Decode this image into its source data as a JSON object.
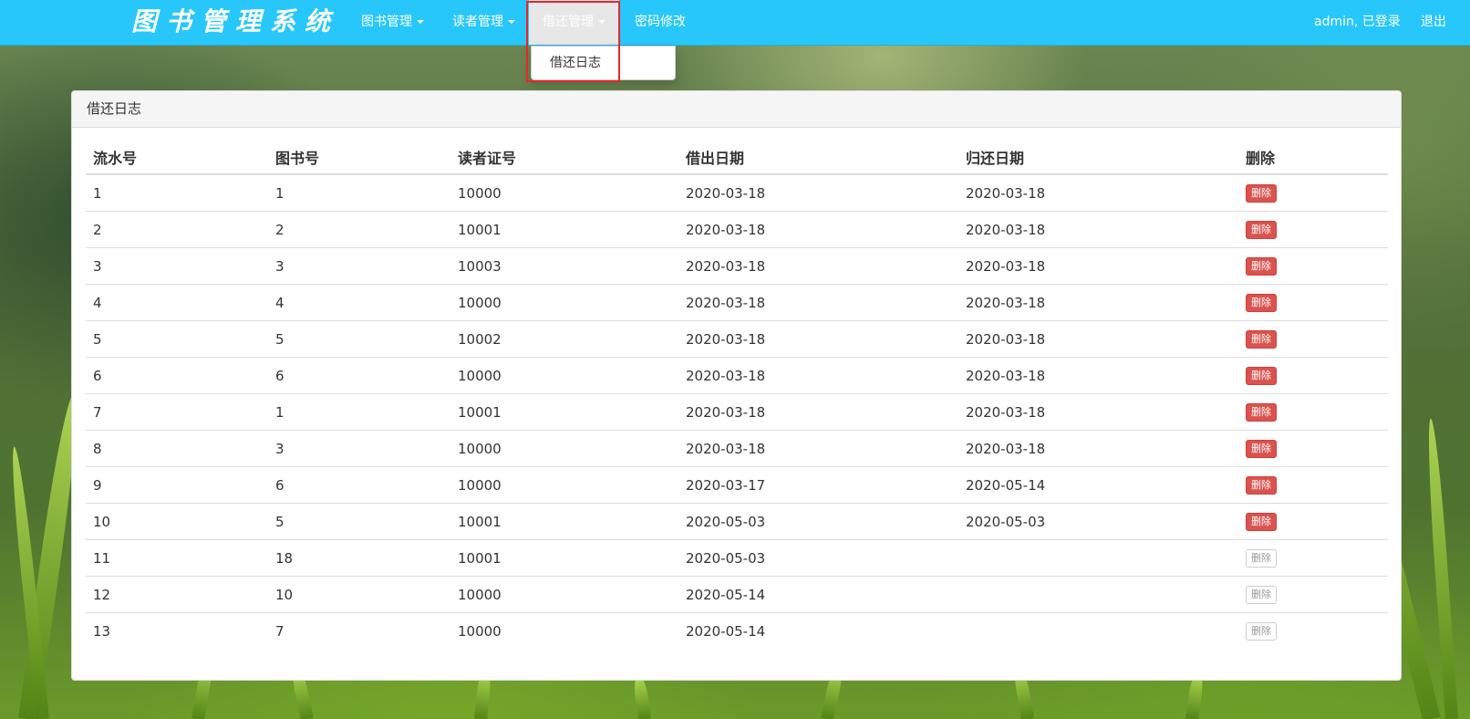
{
  "navbar": {
    "brand": "图书管理系统",
    "items": [
      {
        "label": "图书管理",
        "dropdown": true
      },
      {
        "label": "读者管理",
        "dropdown": true
      },
      {
        "label": "借还管理",
        "dropdown": true
      },
      {
        "label": "密码修改",
        "dropdown": false
      }
    ],
    "user_status": "admin, 已登录",
    "logout": "退出"
  },
  "dropdown": {
    "items": [
      {
        "label": "借还日志"
      }
    ]
  },
  "panel": {
    "title": "借还日志",
    "columns": [
      "流水号",
      "图书号",
      "读者证号",
      "借出日期",
      "归还日期",
      "删除"
    ],
    "delete_label": "删除",
    "rows": [
      {
        "id": "1",
        "book": "1",
        "reader": "10000",
        "lend": "2020-03-18",
        "back": "2020-03-18",
        "returned": true
      },
      {
        "id": "2",
        "book": "2",
        "reader": "10001",
        "lend": "2020-03-18",
        "back": "2020-03-18",
        "returned": true
      },
      {
        "id": "3",
        "book": "3",
        "reader": "10003",
        "lend": "2020-03-18",
        "back": "2020-03-18",
        "returned": true
      },
      {
        "id": "4",
        "book": "4",
        "reader": "10000",
        "lend": "2020-03-18",
        "back": "2020-03-18",
        "returned": true
      },
      {
        "id": "5",
        "book": "5",
        "reader": "10002",
        "lend": "2020-03-18",
        "back": "2020-03-18",
        "returned": true
      },
      {
        "id": "6",
        "book": "6",
        "reader": "10000",
        "lend": "2020-03-18",
        "back": "2020-03-18",
        "returned": true
      },
      {
        "id": "7",
        "book": "1",
        "reader": "10001",
        "lend": "2020-03-18",
        "back": "2020-03-18",
        "returned": true
      },
      {
        "id": "8",
        "book": "3",
        "reader": "10000",
        "lend": "2020-03-18",
        "back": "2020-03-18",
        "returned": true
      },
      {
        "id": "9",
        "book": "6",
        "reader": "10000",
        "lend": "2020-03-17",
        "back": "2020-05-14",
        "returned": true
      },
      {
        "id": "10",
        "book": "5",
        "reader": "10001",
        "lend": "2020-05-03",
        "back": "2020-05-03",
        "returned": true
      },
      {
        "id": "11",
        "book": "18",
        "reader": "10001",
        "lend": "2020-05-03",
        "back": "",
        "returned": false
      },
      {
        "id": "12",
        "book": "10",
        "reader": "10000",
        "lend": "2020-05-14",
        "back": "",
        "returned": false
      },
      {
        "id": "13",
        "book": "7",
        "reader": "10000",
        "lend": "2020-05-14",
        "back": "",
        "returned": false
      }
    ]
  },
  "colors": {
    "navbar": "#27c7fb",
    "danger": "#d9534f",
    "highlight": "#e8262a"
  }
}
